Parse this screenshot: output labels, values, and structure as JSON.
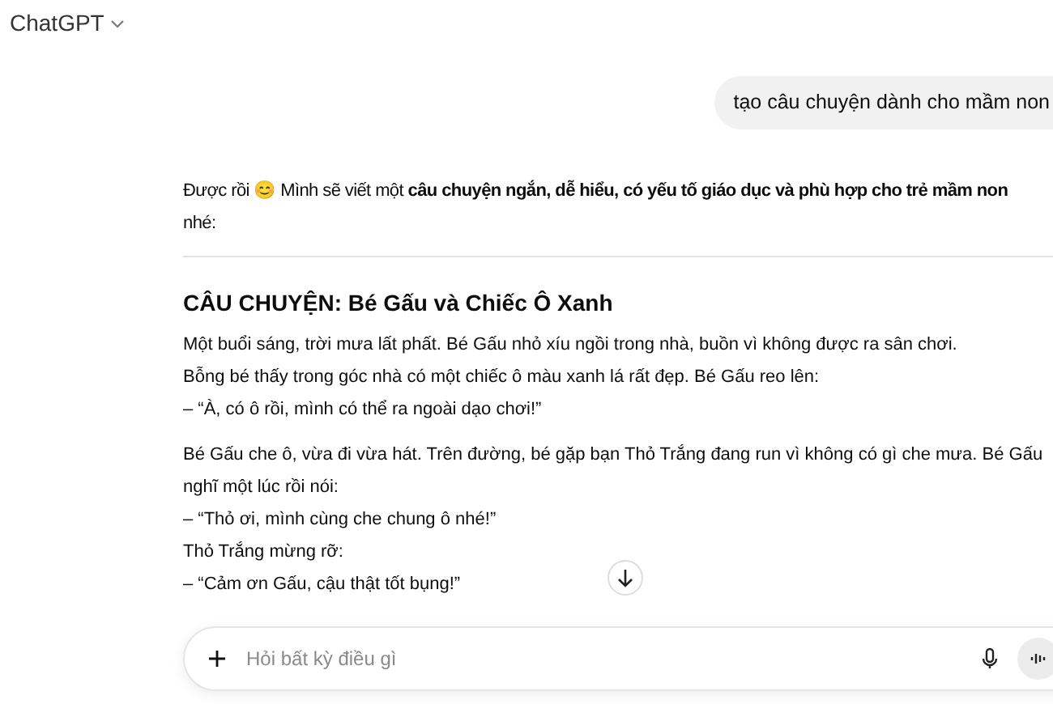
{
  "header": {
    "title": "ChatGPT"
  },
  "user_message": "tạo câu chuyện dành cho mầm non",
  "reply": {
    "intro_lines": [
      "Được rồi 😊 Mình sẽ viết một **câu chuyện ngắn, dễ hiểu, có yếu tố giáo dục và phù hợp cho trẻ mầm non**",
      "nhé:"
    ],
    "heading": "CÂU CHUYỆN: Bé Gấu và Chiếc Ô Xanh",
    "paragraphs": [
      [
        "Một buổi sáng, trời mưa lất phất. Bé Gấu nhỏ xíu ngồi trong nhà, buồn vì không được ra sân chơi.",
        "Bỗng bé thấy trong góc nhà có một chiếc ô màu xanh lá rất đẹp. Bé Gấu reo lên:",
        "– “À, có ô rồi, mình có thể ra ngoài dạo chơi!”"
      ],
      [
        "Bé Gấu che ô, vừa đi vừa hát. Trên đường, bé gặp bạn Thỏ Trắng đang run vì không có gì che mưa. Bé Gấu",
        "nghĩ một lúc rồi nói:",
        "– “Thỏ ơi, mình cùng che chung ô nhé!”",
        "Thỏ Trắng mừng rỡ:",
        "– “Cảm ơn Gấu, cậu thật tốt bụng!”"
      ]
    ]
  },
  "composer": {
    "placeholder": "Hỏi bất kỳ điều gì"
  }
}
